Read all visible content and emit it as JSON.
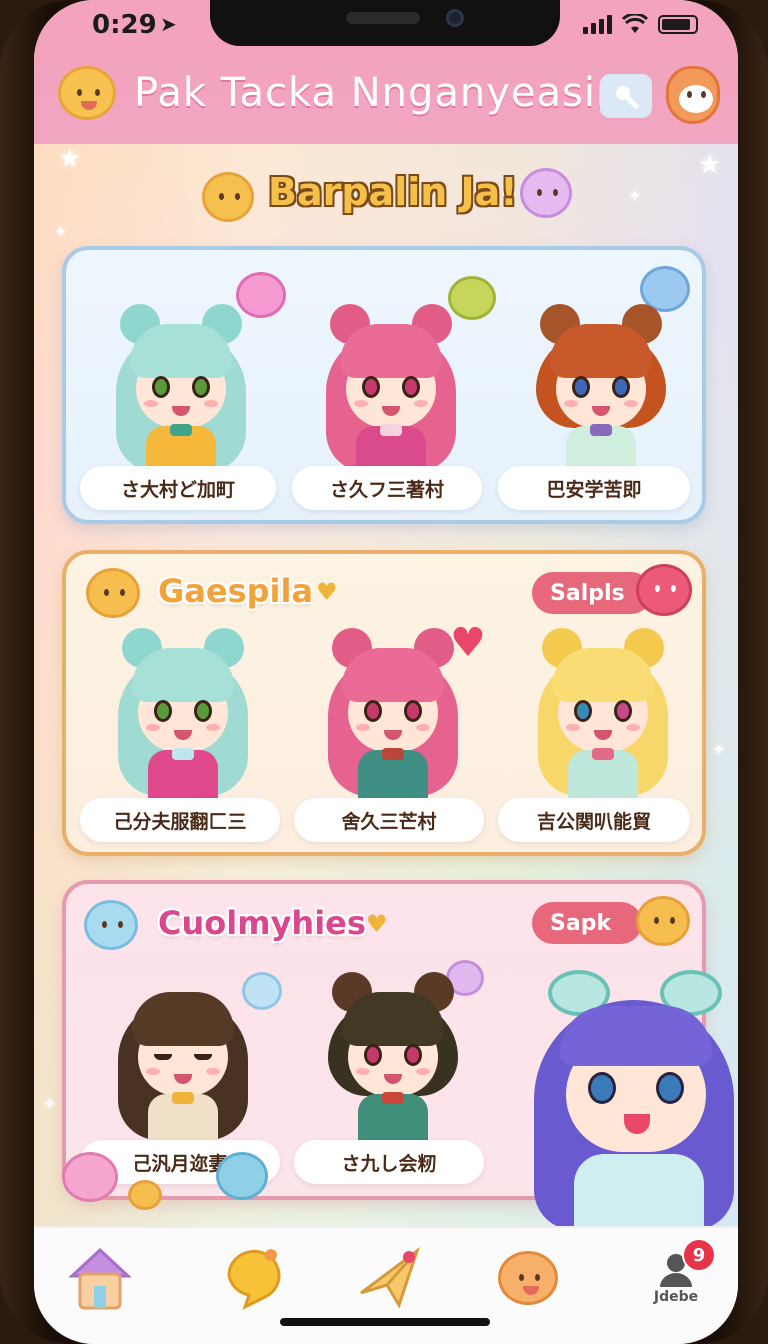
{
  "status_bar": {
    "time": "0:29"
  },
  "header": {
    "title": "Pak Tacka Nnganyeasin"
  },
  "banner": {
    "title": "Barpalin Ja!"
  },
  "sections": [
    {
      "cards": [
        {
          "name": "さ大村ど加町"
        },
        {
          "name": "さ久フ三著村"
        },
        {
          "name": "巴安学苦即"
        }
      ]
    },
    {
      "title": "Gaespila",
      "action_label": "Salpls",
      "cards": [
        {
          "name": "己分夫服翻匚三"
        },
        {
          "name": "舍久三芒村"
        },
        {
          "name": "吉公関叭能貿"
        }
      ]
    },
    {
      "title": "Cuolmyhies",
      "action_label": "Sapk",
      "cards": [
        {
          "name": "己汎月迩妻"
        },
        {
          "name": "さ九し会籾"
        }
      ]
    }
  ],
  "tab_bar": {
    "items": [
      {
        "icon": "home-icon"
      },
      {
        "icon": "chat-bubble-icon"
      },
      {
        "icon": "paper-plane-icon"
      },
      {
        "icon": "bear-face-icon"
      },
      {
        "icon": "profile-icon",
        "label": "Jdebe",
        "badge": "9"
      }
    ]
  },
  "colors": {
    "header_pink": "#f3a3bd",
    "accent_orange": "#e8b06b",
    "accent_blue": "#a9cbe6",
    "accent_rose": "#e79aae",
    "action_red": "#e8687b"
  }
}
